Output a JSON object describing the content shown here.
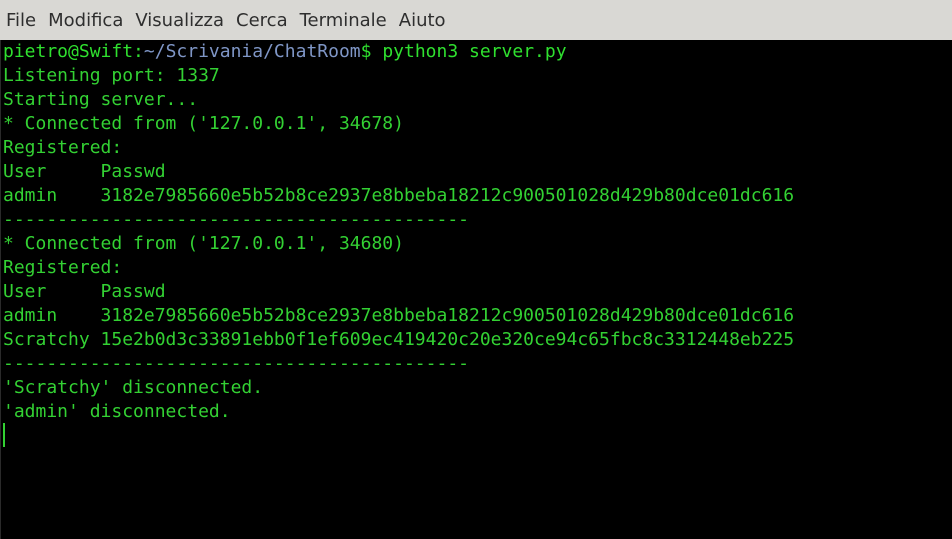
{
  "menu": {
    "file": "File",
    "edit": "Modifica",
    "view": "Visualizza",
    "search": "Cerca",
    "terminal": "Terminale",
    "help": "Aiuto"
  },
  "colors": {
    "menubar_bg": "#d9d8d4",
    "terminal_bg": "#000000",
    "text_green": "#33d133",
    "path_blue": "#7f96c6"
  },
  "terminal": {
    "prompt": {
      "user_host": "pietro@Swift",
      "colon": ":",
      "path": "~/Scrivania/ChatRoom",
      "symbol": "$",
      "command": " python3 server.py"
    },
    "lines": [
      "Listening port: 1337",
      "Starting server...",
      "* Connected from ('127.0.0.1', 34678)",
      "Registered:",
      "User     Passwd",
      "admin    3182e7985660e5b52b8ce2937e8bbeba18212c900501028d429b80dce01dc616",
      "-------------------------------------------",
      "* Connected from ('127.0.0.1', 34680)",
      "Registered:",
      "User     Passwd",
      "admin    3182e7985660e5b52b8ce2937e8bbeba18212c900501028d429b80dce01dc616",
      "Scratchy 15e2b0d3c33891ebb0f1ef609ec419420c20e320ce94c65fbc8c3312448eb225",
      "-------------------------------------------",
      "'Scratchy' disconnected.",
      "'admin' disconnected."
    ]
  }
}
